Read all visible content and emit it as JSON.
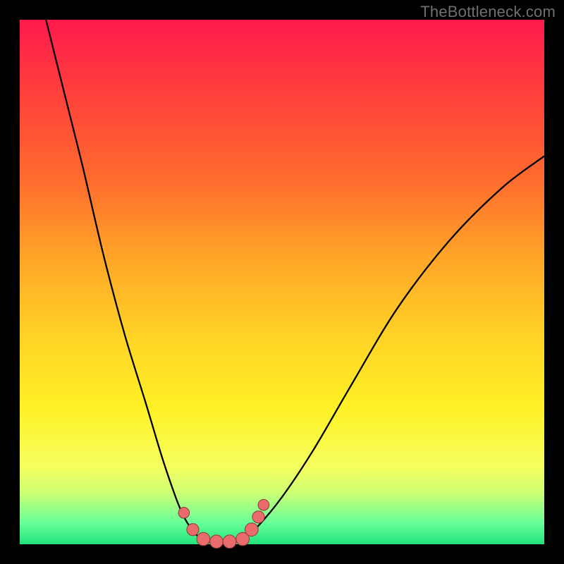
{
  "watermark": "TheBottleneck.com",
  "colors": {
    "bead_fill": "#e96b6b",
    "bead_stroke": "#8c3a3a",
    "curve": "#000000"
  },
  "chart_data": {
    "type": "line",
    "title": "",
    "xlabel": "",
    "ylabel": "",
    "xlim": [
      0,
      100
    ],
    "ylim": [
      0,
      100
    ],
    "grid": false,
    "legend": false,
    "note": "No axis ticks or numeric labels visible; values estimated from pixel positions on a 0-100 normalized scale (y=0 at bottom).",
    "series": [
      {
        "name": "left-branch",
        "x": [
          5,
          8,
          12,
          16,
          20,
          24,
          27,
          29,
          30.5,
          32,
          34,
          36
        ],
        "y": [
          100,
          88,
          72,
          55,
          40,
          27,
          17,
          11,
          7,
          4,
          1.5,
          0.5
        ]
      },
      {
        "name": "valley-floor",
        "x": [
          36,
          38,
          40,
          42
        ],
        "y": [
          0.5,
          0.3,
          0.3,
          0.6
        ]
      },
      {
        "name": "right-branch",
        "x": [
          42,
          45,
          50,
          56,
          63,
          72,
          82,
          92,
          100
        ],
        "y": [
          0.6,
          3,
          9,
          18,
          30,
          45,
          58,
          68,
          74
        ]
      }
    ],
    "markers": [
      {
        "x": 31.3,
        "y": 6.0,
        "r": 1.0
      },
      {
        "x": 33.0,
        "y": 2.8,
        "r": 1.1
      },
      {
        "x": 35.0,
        "y": 1.0,
        "r": 1.2
      },
      {
        "x": 37.5,
        "y": 0.5,
        "r": 1.2
      },
      {
        "x": 40.0,
        "y": 0.5,
        "r": 1.2
      },
      {
        "x": 42.5,
        "y": 1.0,
        "r": 1.2
      },
      {
        "x": 44.2,
        "y": 2.8,
        "r": 1.2
      },
      {
        "x": 45.5,
        "y": 5.2,
        "r": 1.1
      },
      {
        "x": 46.5,
        "y": 7.5,
        "r": 1.0
      }
    ]
  }
}
